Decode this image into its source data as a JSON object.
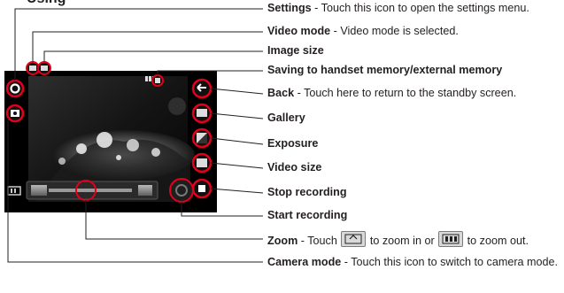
{
  "heading": "Using",
  "callouts": [
    {
      "name": "Settings",
      "desc": " - Touch this icon to open the settings menu."
    },
    {
      "name": "Video mode",
      "desc": " - Video mode is selected."
    },
    {
      "name": "Image size",
      "desc": ""
    },
    {
      "name": "Saving to handset memory/external memory",
      "desc": ""
    },
    {
      "name": "Back",
      "desc": " - Touch here to return to the standby screen."
    },
    {
      "name": "Gallery",
      "desc": ""
    },
    {
      "name": "Exposure",
      "desc": ""
    },
    {
      "name": "Video size",
      "desc": ""
    },
    {
      "name": "Stop recording",
      "desc": ""
    },
    {
      "name": "Start recording",
      "desc": ""
    }
  ],
  "zoom": {
    "name": "Zoom",
    "pre": " - Touch ",
    "mid": " to zoom in or ",
    "post": " to zoom out."
  },
  "camera_mode": {
    "name": "Camera mode",
    "desc": " - Touch this icon to switch to camera mode."
  },
  "colors": {
    "callout_line": "#231f20",
    "highlight": "#e3001b",
    "button": "#1a1a1a"
  }
}
